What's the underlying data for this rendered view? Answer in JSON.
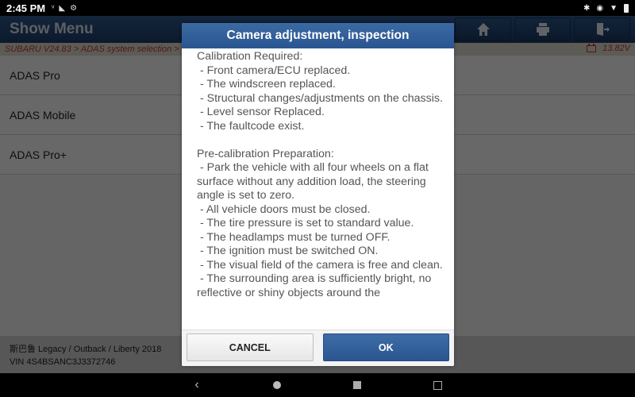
{
  "status_bar": {
    "time": "2:45 PM",
    "left_icons": [
      "vibrate-icon",
      "cast-icon",
      "settings-badge-icon"
    ],
    "right_icons": [
      "bluetooth-icon",
      "eye-icon",
      "wifi-icon",
      "battery-icon"
    ]
  },
  "header": {
    "title": "Show Menu",
    "buttons": [
      {
        "name": "home",
        "icon": "home-icon"
      },
      {
        "name": "print",
        "icon": "printer-icon"
      },
      {
        "name": "exit",
        "icon": "exit-icon"
      }
    ]
  },
  "breadcrumb": {
    "text": "SUBARU V24.83 > ADAS system selection > E",
    "voltage": "13.82V"
  },
  "menu": {
    "items": [
      {
        "label": "ADAS Pro"
      },
      {
        "label": "ADAS Mobile"
      },
      {
        "label": "ADAS Pro+"
      }
    ]
  },
  "vehicle": {
    "model": "斯巴鲁 Legacy / Outback / Liberty 2018",
    "vin": "VIN 4S4BSANC3J3372746"
  },
  "dialog": {
    "title": "Camera adjustment, inspection",
    "sections": [
      {
        "heading": "Calibration Required:",
        "lines": [
          " - Front camera/ECU replaced.",
          " - The windscreen replaced.",
          " - Structural changes/adjustments on the chassis.",
          " - Level sensor Replaced.",
          " - The faultcode exist."
        ]
      },
      {
        "heading": "Pre-calibration Preparation:",
        "lines": [
          " - Park the vehicle with all four wheels on a flat surface without any addition load, the steering angle is set to zero.",
          " - All vehicle doors must be closed.",
          " - The tire pressure is set to standard value.",
          " - The headlamps must be turned OFF.",
          " - The ignition must be switched ON.",
          " - The visual field of the camera is free and clean.",
          " - The surrounding area is sufficiently bright, no reflective or shiny objects around the"
        ]
      }
    ],
    "cancel_label": "CANCEL",
    "ok_label": "OK"
  },
  "nav_bar": {
    "buttons": [
      "back-icon",
      "home-circle-icon",
      "recents-icon",
      "screenshot-icon"
    ]
  },
  "colors": {
    "header_blue": "#2a5590",
    "breadcrumb_red": "#c0392b",
    "ok_blue": "#2a5590"
  }
}
